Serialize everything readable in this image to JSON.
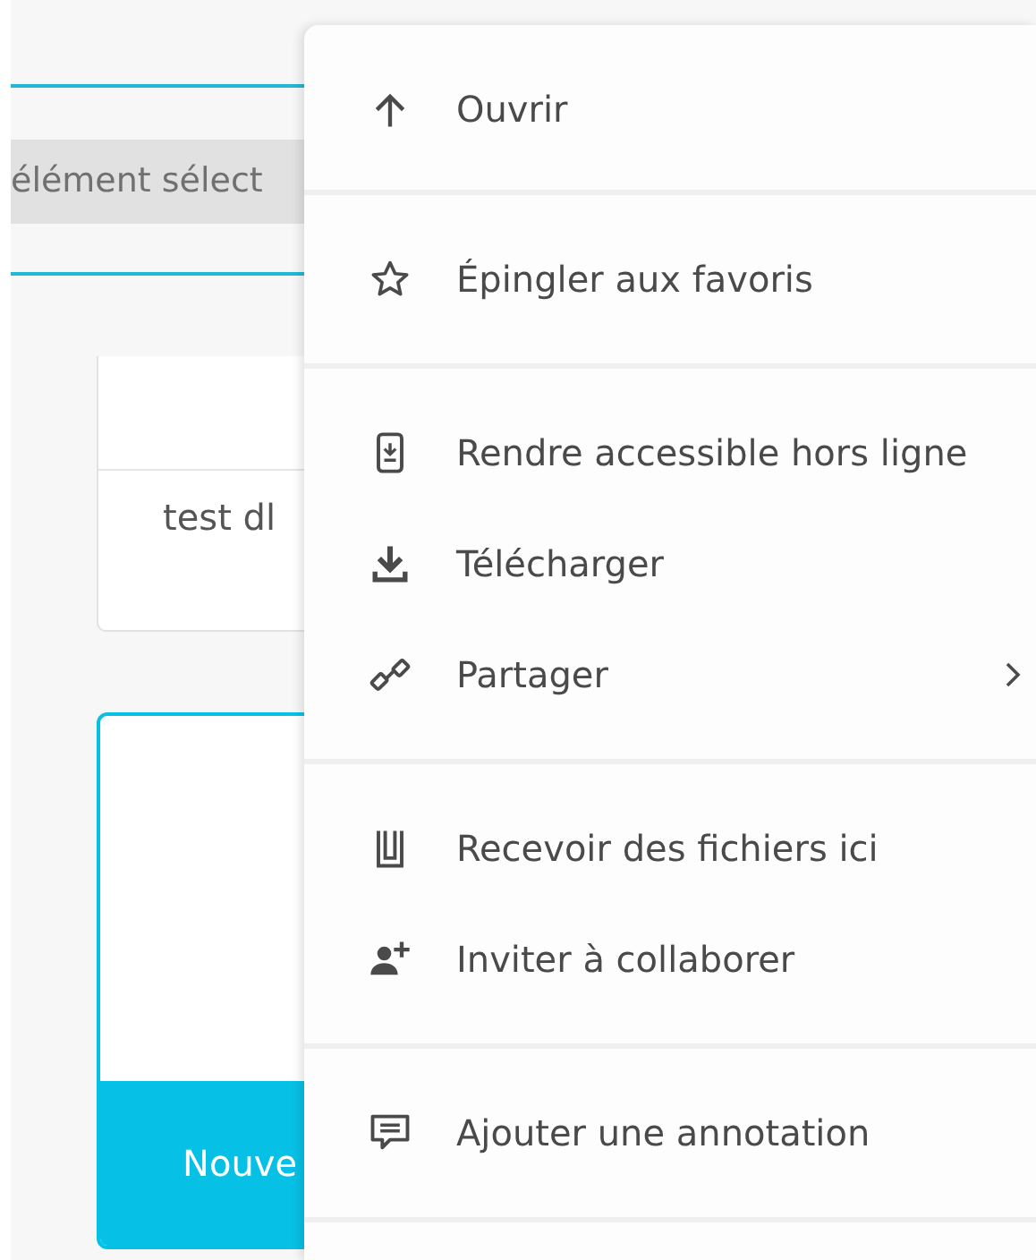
{
  "background": {
    "selection_bar": {
      "text": "élément sélect"
    },
    "file_card": {
      "row_text": "test dl"
    },
    "new_card": {
      "button_label": "Nouve"
    }
  },
  "context_menu": {
    "sections": [
      {
        "items": [
          {
            "kind": "open",
            "label": "Ouvrir",
            "submenu": false
          }
        ]
      },
      {
        "items": [
          {
            "kind": "pin",
            "label": "Épingler aux favoris",
            "submenu": false
          }
        ]
      },
      {
        "items": [
          {
            "kind": "offline",
            "label": "Rendre accessible hors ligne",
            "submenu": false
          },
          {
            "kind": "download",
            "label": "Télécharger",
            "submenu": false
          },
          {
            "kind": "share",
            "label": "Partager",
            "submenu": true
          }
        ]
      },
      {
        "items": [
          {
            "kind": "receive",
            "label": "Recevoir des fichiers ici",
            "submenu": false
          },
          {
            "kind": "invite",
            "label": "Inviter à collaborer",
            "submenu": false
          }
        ]
      },
      {
        "items": [
          {
            "kind": "annotate",
            "label": "Ajouter une annotation",
            "submenu": false
          }
        ]
      }
    ]
  }
}
